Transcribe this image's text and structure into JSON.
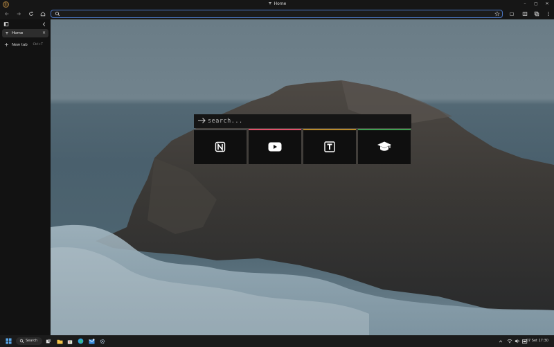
{
  "window": {
    "title": "Home",
    "app_badge": "J"
  },
  "toolbar": {
    "url_value": ""
  },
  "sidebar": {
    "tabs": [
      {
        "label": "Home",
        "close": "×"
      }
    ],
    "new_tab": {
      "label": "New tab",
      "shortcut": "Ctrl+T"
    }
  },
  "newtab_page": {
    "search_placeholder": "search...",
    "tiles": [
      {
        "name": "Notion",
        "icon": "notion-icon",
        "color": "#4a4a4a"
      },
      {
        "name": "YouTube",
        "icon": "youtube-icon",
        "color": "#e0516a"
      },
      {
        "name": "Typeform",
        "icon": "t-square-icon",
        "color": "#b88a2b"
      },
      {
        "name": "Learning",
        "icon": "graduation-cap-icon",
        "color": "#3f9f52"
      }
    ]
  },
  "taskbar": {
    "search_label": "Search",
    "clock": "07 Set 17:30"
  },
  "colors": {
    "accent": "#4a77c6",
    "chrome": "#161616"
  }
}
